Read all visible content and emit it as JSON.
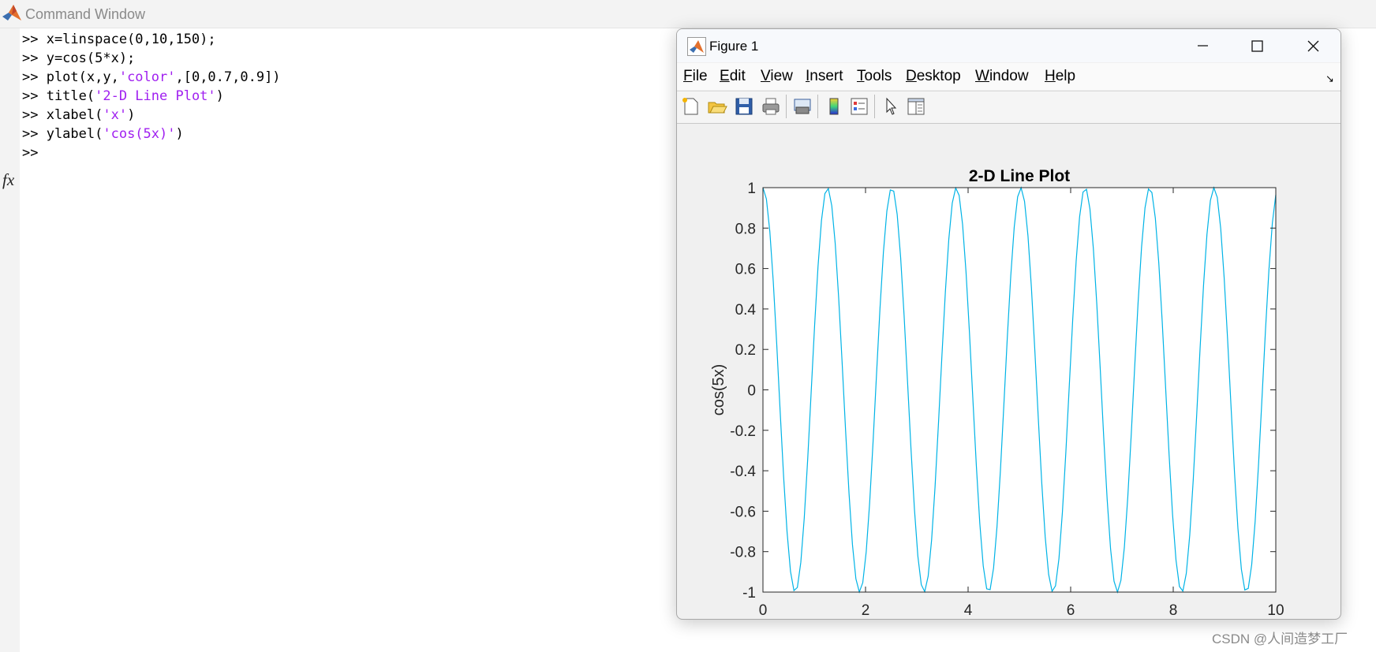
{
  "command_window": {
    "title": "Command Window",
    "lines": [
      [
        {
          "t": ">> x=linspace(0,10,150);",
          "s": false
        }
      ],
      [
        {
          "t": ">> y=cos(5*x);",
          "s": false
        }
      ],
      [
        {
          "t": ">> plot(x,y,",
          "s": false
        },
        {
          "t": "'color'",
          "s": true
        },
        {
          "t": ",[0,0.7,0.9])",
          "s": false
        }
      ],
      [
        {
          "t": ">> title(",
          "s": false
        },
        {
          "t": "'2-D Line Plot'",
          "s": true
        },
        {
          "t": ")",
          "s": false
        }
      ],
      [
        {
          "t": ">> xlabel(",
          "s": false
        },
        {
          "t": "'x'",
          "s": true
        },
        {
          "t": ")",
          "s": false
        }
      ],
      [
        {
          "t": ">> ylabel(",
          "s": false
        },
        {
          "t": "'cos(5x)'",
          "s": true
        },
        {
          "t": ")",
          "s": false
        }
      ],
      [
        {
          "t": ">>",
          "s": false
        }
      ]
    ],
    "fx_label": "fx",
    "string_color": "#a020f0"
  },
  "figure": {
    "title": "Figure 1",
    "menus": [
      {
        "hotkey": "F",
        "rest": "ile"
      },
      {
        "hotkey": "E",
        "rest": "dit"
      },
      {
        "hotkey": "V",
        "rest": "iew"
      },
      {
        "hotkey": "I",
        "rest": "nsert"
      },
      {
        "hotkey": "T",
        "rest": "ools"
      },
      {
        "hotkey": "D",
        "rest": "esktop"
      },
      {
        "hotkey": "W",
        "rest": "indow"
      },
      {
        "hotkey": "H",
        "rest": "elp"
      }
    ],
    "toolbar": [
      "new-figure-icon",
      "open-file-icon",
      "save-icon",
      "print-icon",
      "print-preview-icon",
      "colorbar-icon",
      "legend-icon",
      "pointer-icon",
      "property-inspector-icon"
    ]
  },
  "chart_data": {
    "type": "line",
    "title": "2-D Line Plot",
    "xlabel": "x",
    "ylabel": "cos(5x)",
    "xlim": [
      0,
      10
    ],
    "ylim": [
      -1,
      1
    ],
    "xticks": [
      0,
      2,
      4,
      6,
      8,
      10
    ],
    "yticks": [
      -1,
      -0.8,
      -0.6,
      -0.4,
      -0.2,
      0,
      0.2,
      0.4,
      0.6,
      0.8,
      1
    ],
    "grid": false,
    "line_color": "#00b3e6",
    "series": [
      {
        "function": "y = cos(5x)",
        "x_start": 0,
        "x_end": 10,
        "num_points": 150
      }
    ]
  },
  "watermark": "CSDN @人间造梦工厂"
}
